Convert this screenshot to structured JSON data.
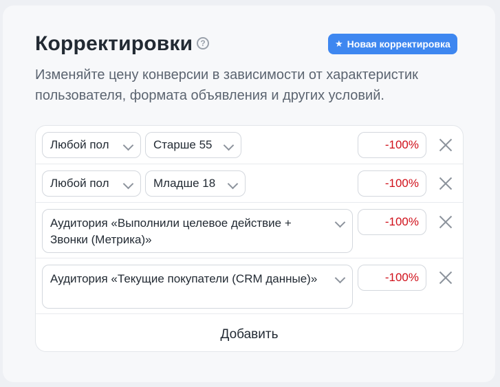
{
  "header": {
    "title": "Корректировки",
    "help_glyph": "?",
    "new_button_label": "Новая корректировка",
    "description": "Изменяйте цену конверсии в зависимости от характеристик пользователя, формата объявления и других условий."
  },
  "rows": [
    {
      "gender": "Любой пол",
      "age": "Старше 55",
      "value": "-100%"
    },
    {
      "gender": "Любой пол",
      "age": "Младше 18",
      "value": "-100%"
    },
    {
      "audience": "Аудитория «Выполнили целевое действие + Звонки (Метрика)»",
      "value": "-100%"
    },
    {
      "audience": "Аудитория «Текущие покупатели (CRM данные)»",
      "value": "-100%"
    }
  ],
  "add_label": "Добавить",
  "colors": {
    "accent": "#3e87f0",
    "negative": "#d0101a"
  }
}
